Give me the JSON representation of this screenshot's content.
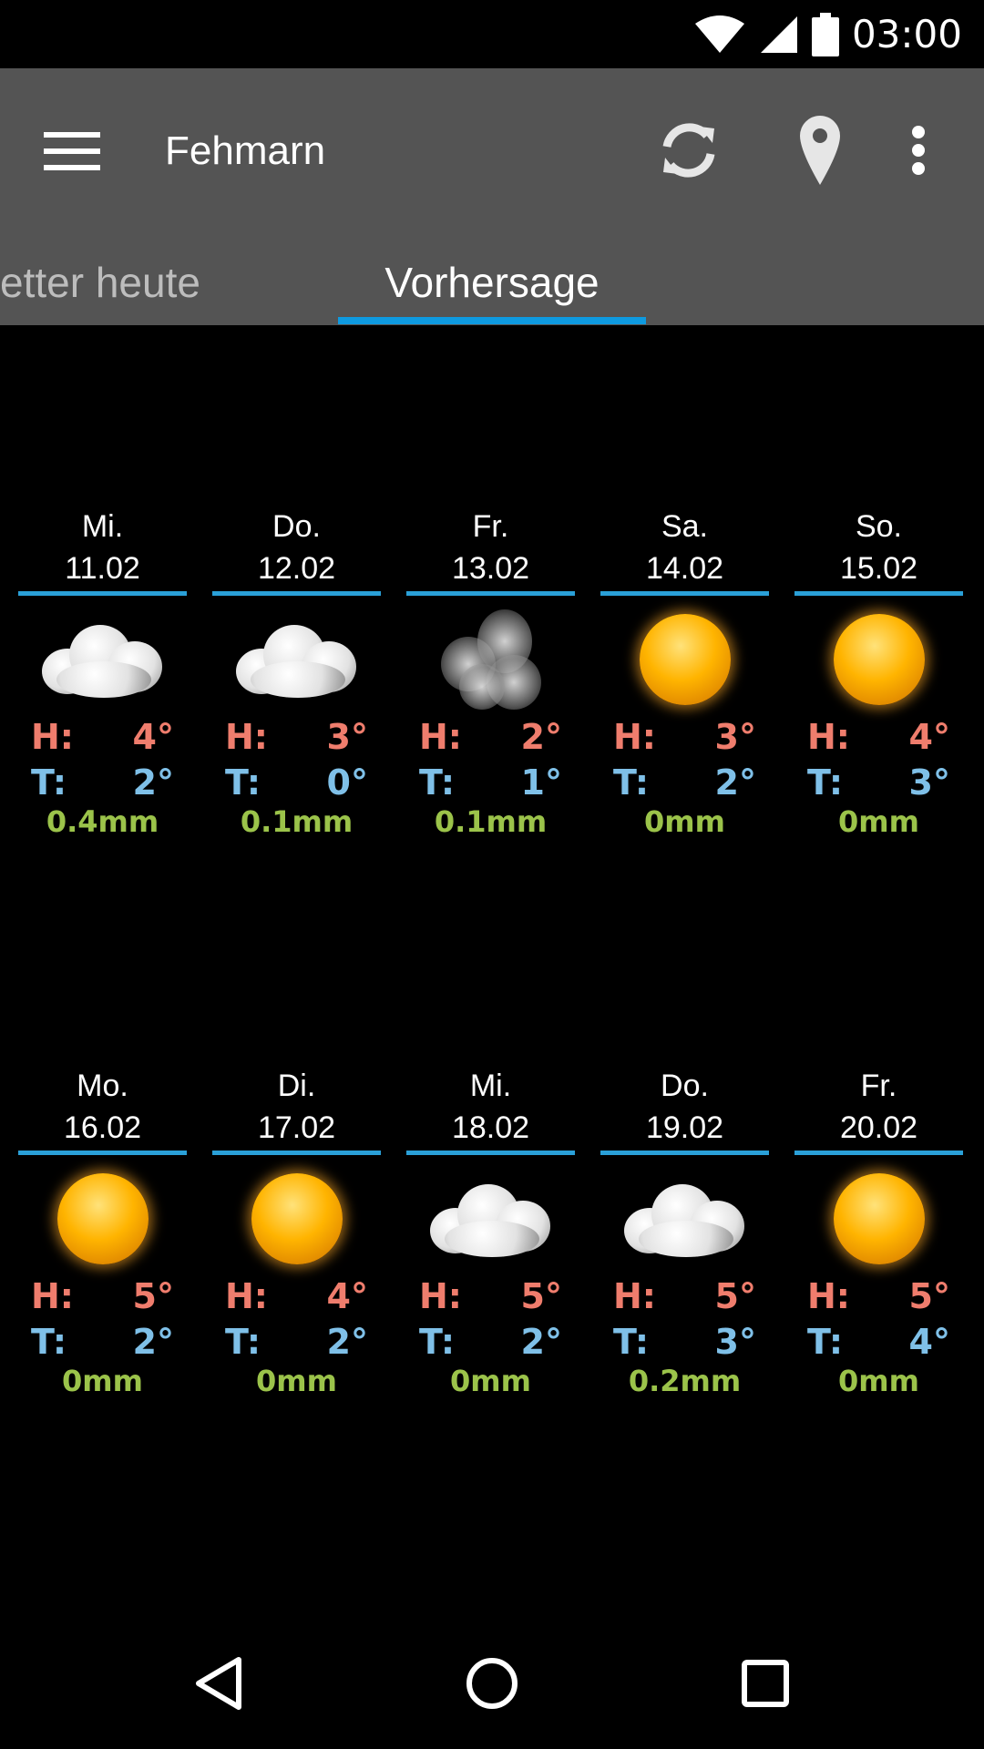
{
  "status_bar": {
    "time": "03:00"
  },
  "app_bar": {
    "title": "Fehmarn",
    "actions": {
      "refresh": "refresh-icon",
      "location": "location-pin-icon",
      "more": "more-vert-icon"
    }
  },
  "tabs": [
    {
      "label": "etter heute",
      "active": false
    },
    {
      "label": "Vorhersage",
      "active": true
    }
  ],
  "labels": {
    "high": "H:",
    "low": "T:"
  },
  "colors": {
    "accent": "#0e9ae0",
    "high": "#ef7d6d",
    "low": "#7fc0e8",
    "rain": "#9bc34a",
    "appbar": "#545454"
  },
  "forecast": [
    {
      "day": "Mi.",
      "date": "11.02",
      "icon": "cloud-icon",
      "high": "4°",
      "low": "2°",
      "rain": "0.4mm"
    },
    {
      "day": "Do.",
      "date": "12.02",
      "icon": "cloud-icon",
      "high": "3°",
      "low": "0°",
      "rain": "0.1mm"
    },
    {
      "day": "Fr.",
      "date": "13.02",
      "icon": "fog-icon",
      "high": "2°",
      "low": "1°",
      "rain": "0.1mm"
    },
    {
      "day": "Sa.",
      "date": "14.02",
      "icon": "sun-icon",
      "high": "3°",
      "low": "2°",
      "rain": "0mm"
    },
    {
      "day": "So.",
      "date": "15.02",
      "icon": "sun-icon",
      "high": "4°",
      "low": "3°",
      "rain": "0mm"
    },
    {
      "day": "Mo.",
      "date": "16.02",
      "icon": "sun-icon",
      "high": "5°",
      "low": "2°",
      "rain": "0mm"
    },
    {
      "day": "Di.",
      "date": "17.02",
      "icon": "sun-icon",
      "high": "4°",
      "low": "2°",
      "rain": "0mm"
    },
    {
      "day": "Mi.",
      "date": "18.02",
      "icon": "cloud-icon",
      "high": "5°",
      "low": "2°",
      "rain": "0mm"
    },
    {
      "day": "Do.",
      "date": "19.02",
      "icon": "cloud-icon",
      "high": "5°",
      "low": "3°",
      "rain": "0.2mm"
    },
    {
      "day": "Fr.",
      "date": "20.02",
      "icon": "sun-icon",
      "high": "5°",
      "low": "4°",
      "rain": "0mm"
    }
  ]
}
